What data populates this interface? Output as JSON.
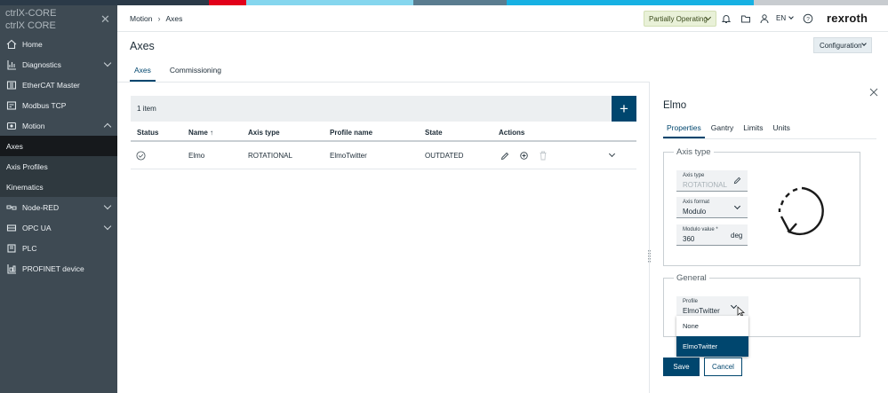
{
  "colors": {
    "strip": [
      "#2b3a48",
      "#e2001a",
      "#85d6ee",
      "#5a7c8f",
      "#17b1e3",
      "#c8ccd0"
    ],
    "sidebar_bg": "#3e4a53",
    "accent": "#00466e",
    "status_bg": "#e9f1d8"
  },
  "sidebar": {
    "brand": "ctrlX-CORE",
    "brand_sub": "ctrlX CORE",
    "items": [
      {
        "label": "Home",
        "icon": "home-icon"
      },
      {
        "label": "Diagnostics",
        "icon": "diagnostics-icon"
      },
      {
        "label": "EtherCAT Master",
        "icon": "ethercat-icon"
      },
      {
        "label": "Modbus TCP",
        "icon": "modbus-icon"
      },
      {
        "label": "Motion",
        "icon": "motion-icon"
      },
      {
        "label": "Node-RED",
        "icon": "node-red-icon"
      },
      {
        "label": "OPC UA",
        "icon": "opcua-icon"
      },
      {
        "label": "PLC",
        "icon": "plc-icon"
      },
      {
        "label": "PROFINET device",
        "icon": "profinet-icon"
      }
    ],
    "motion_sub": [
      "Axes",
      "Axis Profiles",
      "Kinematics"
    ]
  },
  "topbar": {
    "breadcrumb": [
      "Motion",
      "Axes"
    ],
    "status": "Partially Operating",
    "language": "EN",
    "logo": "rexroth"
  },
  "page": {
    "title": "Axes",
    "config_button": "Configuration",
    "tabs": [
      "Axes",
      "Commissioning"
    ]
  },
  "list": {
    "count": "1 item",
    "columns": [
      "Status",
      "Name ↑",
      "Axis type",
      "Profile name",
      "State",
      "Actions"
    ],
    "rows": [
      {
        "name": "Elmo",
        "axis_type": "ROTATIONAL",
        "profile": "ElmoTwitter",
        "state": "OUTDATED"
      }
    ]
  },
  "panel": {
    "title": "Elmo",
    "tabs": [
      "Properties",
      "Gantry",
      "Limits",
      "Units"
    ],
    "axis_type_group": "Axis type",
    "axis_type_label": "Axis type",
    "axis_type_value": "ROTATIONAL",
    "axis_format_label": "Axis format",
    "axis_format_value": "Modulo",
    "modulo_label": "Modulo value *",
    "modulo_value": "360",
    "modulo_unit": "deg",
    "general_group": "General",
    "profile_label": "Profile",
    "profile_value": "ElmoTwitter",
    "profile_options": [
      "None",
      "ElmoTwitter"
    ],
    "save": "Save",
    "cancel": "Cancel"
  }
}
